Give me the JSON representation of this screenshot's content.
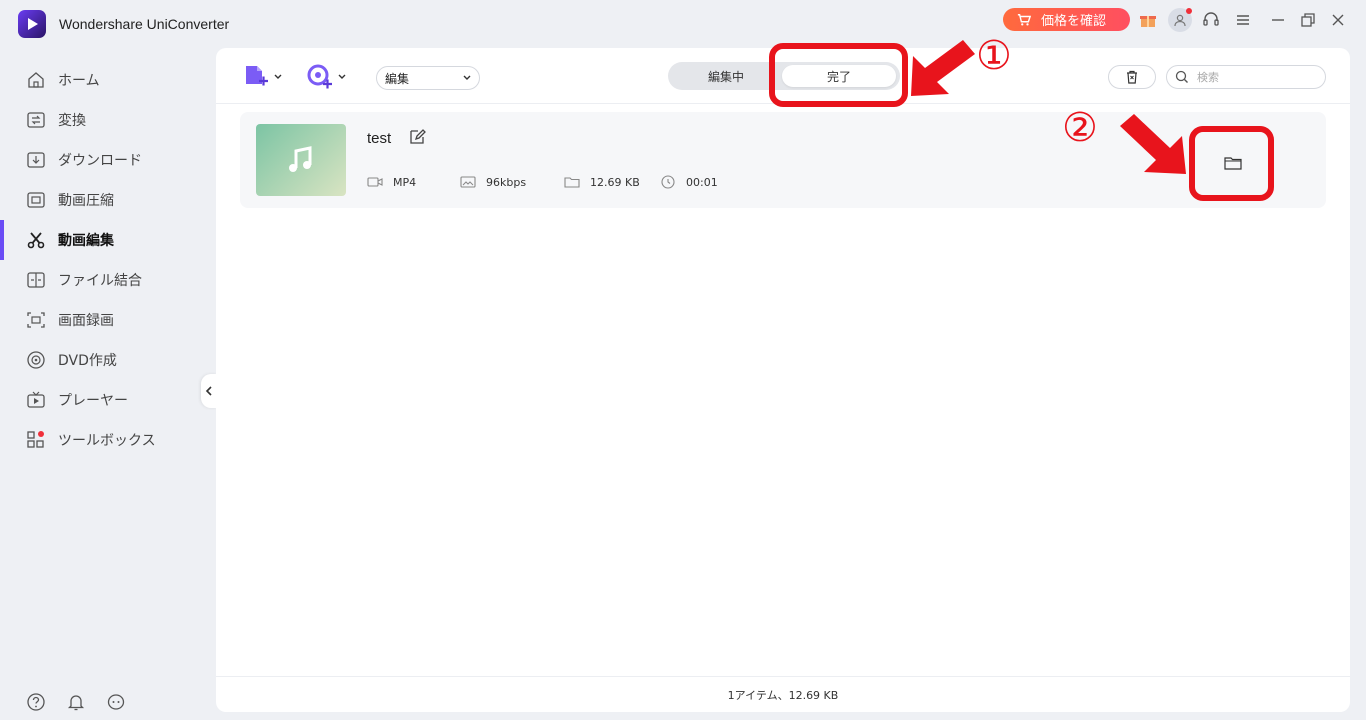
{
  "app": {
    "title": "Wondershare UniConverter"
  },
  "titlebar": {
    "price_button": "価格を確認",
    "icons": [
      "cart-icon",
      "gift-icon",
      "user-icon",
      "headset-icon",
      "menu-icon",
      "minimize-icon",
      "restore-icon",
      "close-icon"
    ]
  },
  "sidebar": {
    "items": [
      {
        "label": "ホーム",
        "icon": "home-icon"
      },
      {
        "label": "変換",
        "icon": "convert-icon"
      },
      {
        "label": "ダウンロード",
        "icon": "download-icon"
      },
      {
        "label": "動画圧縮",
        "icon": "compress-icon"
      },
      {
        "label": "動画編集",
        "icon": "scissors-icon",
        "active": true
      },
      {
        "label": "ファイル結合",
        "icon": "merge-icon"
      },
      {
        "label": "画面録画",
        "icon": "record-icon"
      },
      {
        "label": "DVD作成",
        "icon": "dvd-icon"
      },
      {
        "label": "プレーヤー",
        "icon": "player-icon"
      },
      {
        "label": "ツールボックス",
        "icon": "toolbox-icon"
      }
    ],
    "bottom_icons": [
      "help-icon",
      "bell-icon",
      "feedback-icon"
    ]
  },
  "toolbar": {
    "edit_select": "編集",
    "tabs": [
      {
        "label": "編集中",
        "active": false
      },
      {
        "label": "完了",
        "active": true
      }
    ],
    "search_placeholder": "検索"
  },
  "file": {
    "name": "test",
    "format": "MP4",
    "bitrate": "96kbps",
    "size": "12.69 KB",
    "duration": "00:01"
  },
  "status": {
    "text": "1アイテム、12.69 KB"
  },
  "annotations": {
    "step1": "①",
    "step2": "②"
  },
  "colors": {
    "accent": "#6a4cf5",
    "annotation": "#e8141c",
    "price": "#ff5a4a"
  }
}
